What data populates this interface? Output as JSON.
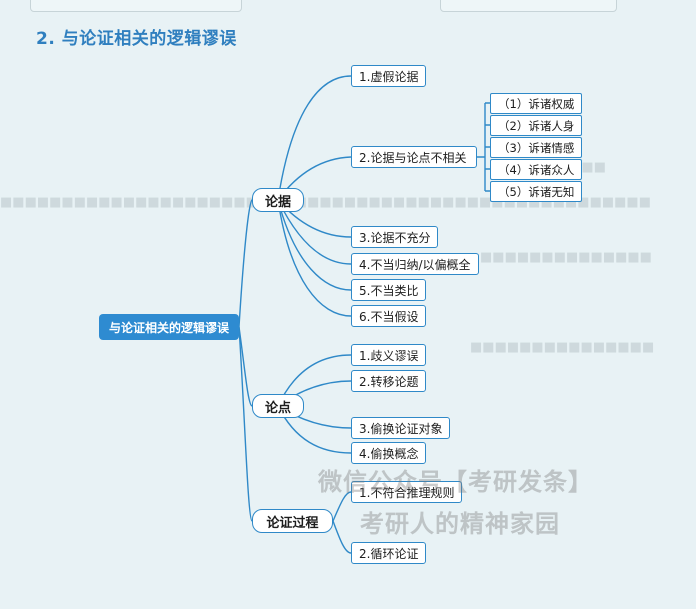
{
  "heading": "2. 与论证相关的逻辑谬误",
  "root": "与论证相关的逻辑谬误",
  "branches": {
    "evidence": {
      "label": "论据",
      "children": [
        "1.虚假论据",
        "2.论据与论点不相关",
        "3.论据不充分",
        "4.不当归纳/以偏概全",
        "5.不当类比",
        "6.不当假设"
      ],
      "irrelevant_types": [
        "（1）诉诸权威",
        "（2）诉诸人身",
        "（3）诉诸情感",
        "（4）诉诸众人",
        "（5）诉诸无知"
      ]
    },
    "thesis": {
      "label": "论点",
      "children": [
        "1.歧义谬误",
        "2.转移论题",
        "3.偷换论证对象",
        "4.偷换概念"
      ]
    },
    "process": {
      "label": "论证过程",
      "children": [
        "1.不符合推理规则",
        "2.循环论证"
      ]
    }
  },
  "watermark": {
    "line1": "微信公众号【考研发条】",
    "line2": "考研人的精神家园"
  },
  "colors": {
    "accent": "#2e8bd1",
    "line": "#2f89c8",
    "background": "#e8f2f5"
  }
}
